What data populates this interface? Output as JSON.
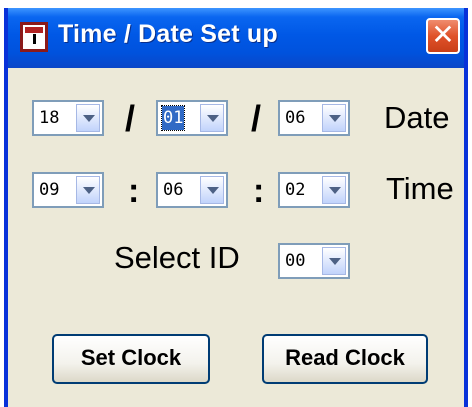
{
  "window": {
    "title": "Time / Date Set up",
    "close_symbol": "✕"
  },
  "date": {
    "day": "18",
    "month": "01",
    "year": "06",
    "separator": "/",
    "label": "Date"
  },
  "time": {
    "hour": "09",
    "minute": "06",
    "second": "02",
    "separator": ":",
    "label": "Time"
  },
  "select_id": {
    "label": "Select ID",
    "value": "00"
  },
  "buttons": {
    "set_clock": "Set Clock",
    "read_clock": "Read Clock"
  },
  "colors": {
    "titlebar": "#0058e6",
    "close": "#e0522a",
    "face": "#ece9d8",
    "selection": "#316ac5"
  }
}
